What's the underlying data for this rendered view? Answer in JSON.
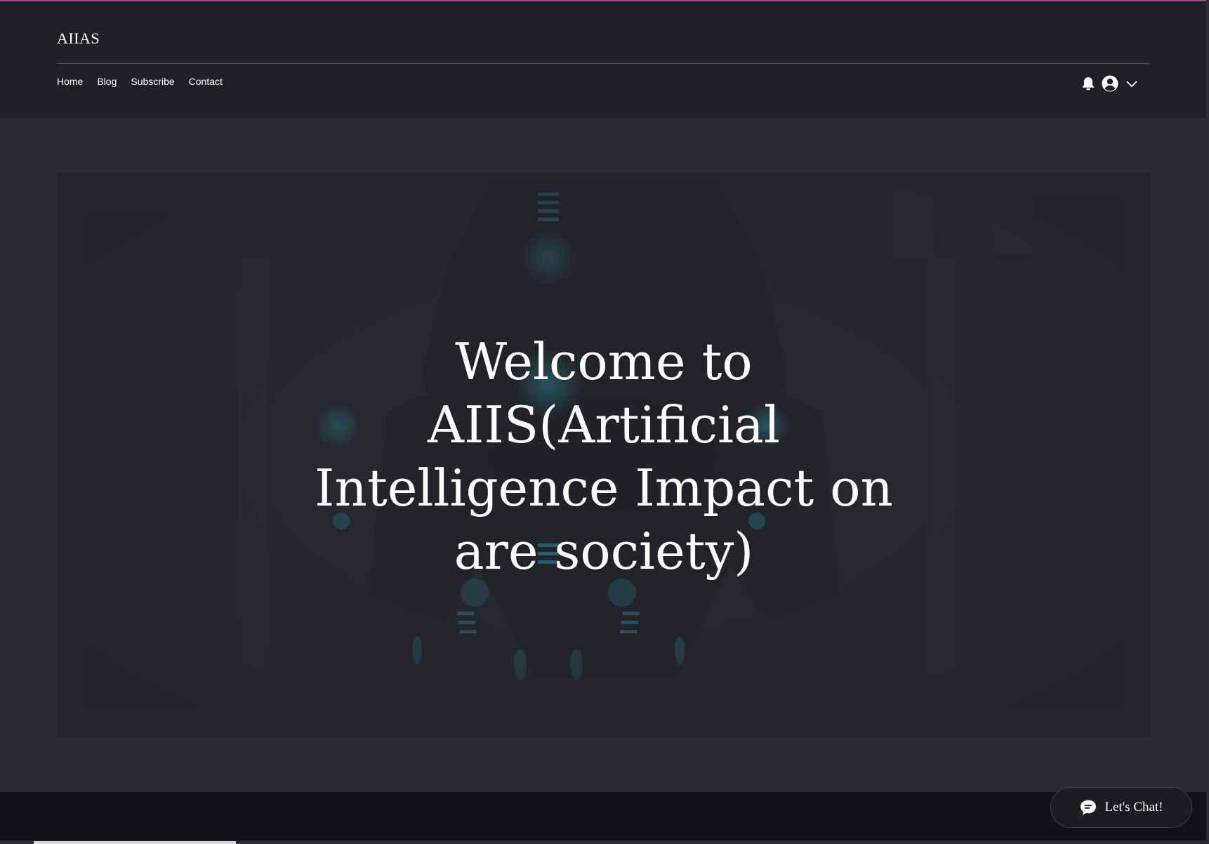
{
  "site": {
    "title": "AIIAS"
  },
  "nav": {
    "items": [
      {
        "label": "Home"
      },
      {
        "label": "Blog"
      },
      {
        "label": "Subscribe"
      },
      {
        "label": "Contact"
      }
    ]
  },
  "header_actions": {
    "icons": [
      "bell-icon",
      "user-avatar-icon",
      "chevron-down-icon"
    ]
  },
  "hero": {
    "heading": "Welcome to AIIS(Artificial Intelligence Impact on are society)"
  },
  "chat": {
    "label": "Let's Chat!",
    "icon": "chat-bubble-icon"
  },
  "colors": {
    "page_background": "#202126",
    "hero_background": "#2b2c32",
    "footer_background": "#121316",
    "accent_top_border": "#a5478c",
    "text": "#ffffff",
    "robot_glow": "#1f6f80"
  }
}
